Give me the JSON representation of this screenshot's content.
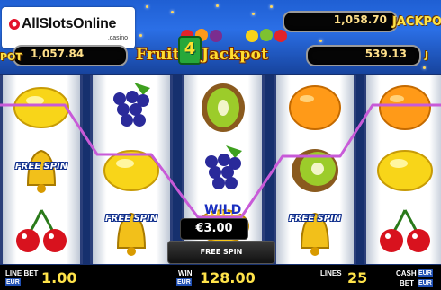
{
  "watermark": {
    "main": "AllSlotsOnline",
    "sub": ".casino"
  },
  "header": {
    "title_left": "Fruits",
    "title_num": "4",
    "title_right": "Jackpot",
    "jackpot_badge": "JACKPOT",
    "jackpot_badge_left": "POT",
    "jackpots": [
      "1,058.70",
      "1,057.84",
      "539.13"
    ]
  },
  "reels": {
    "free_spin_label": "FREE SPIN",
    "wild_label": "WILD"
  },
  "popup": {
    "win_amount": "€3.00",
    "button_label": "FREE SPIN"
  },
  "footer": {
    "line_bet_label": "LINE BET",
    "line_bet_value": "1.00",
    "win_label": "WIN",
    "win_value": "128.00",
    "lines_label": "LINES",
    "lines_value": "25",
    "cash_label": "CASH",
    "bet_label": "BET",
    "currency": "EUR"
  },
  "colors": {
    "accent": "#ffe34a",
    "payline": "#c85ad8",
    "top_bar": "#2b6fe6"
  }
}
